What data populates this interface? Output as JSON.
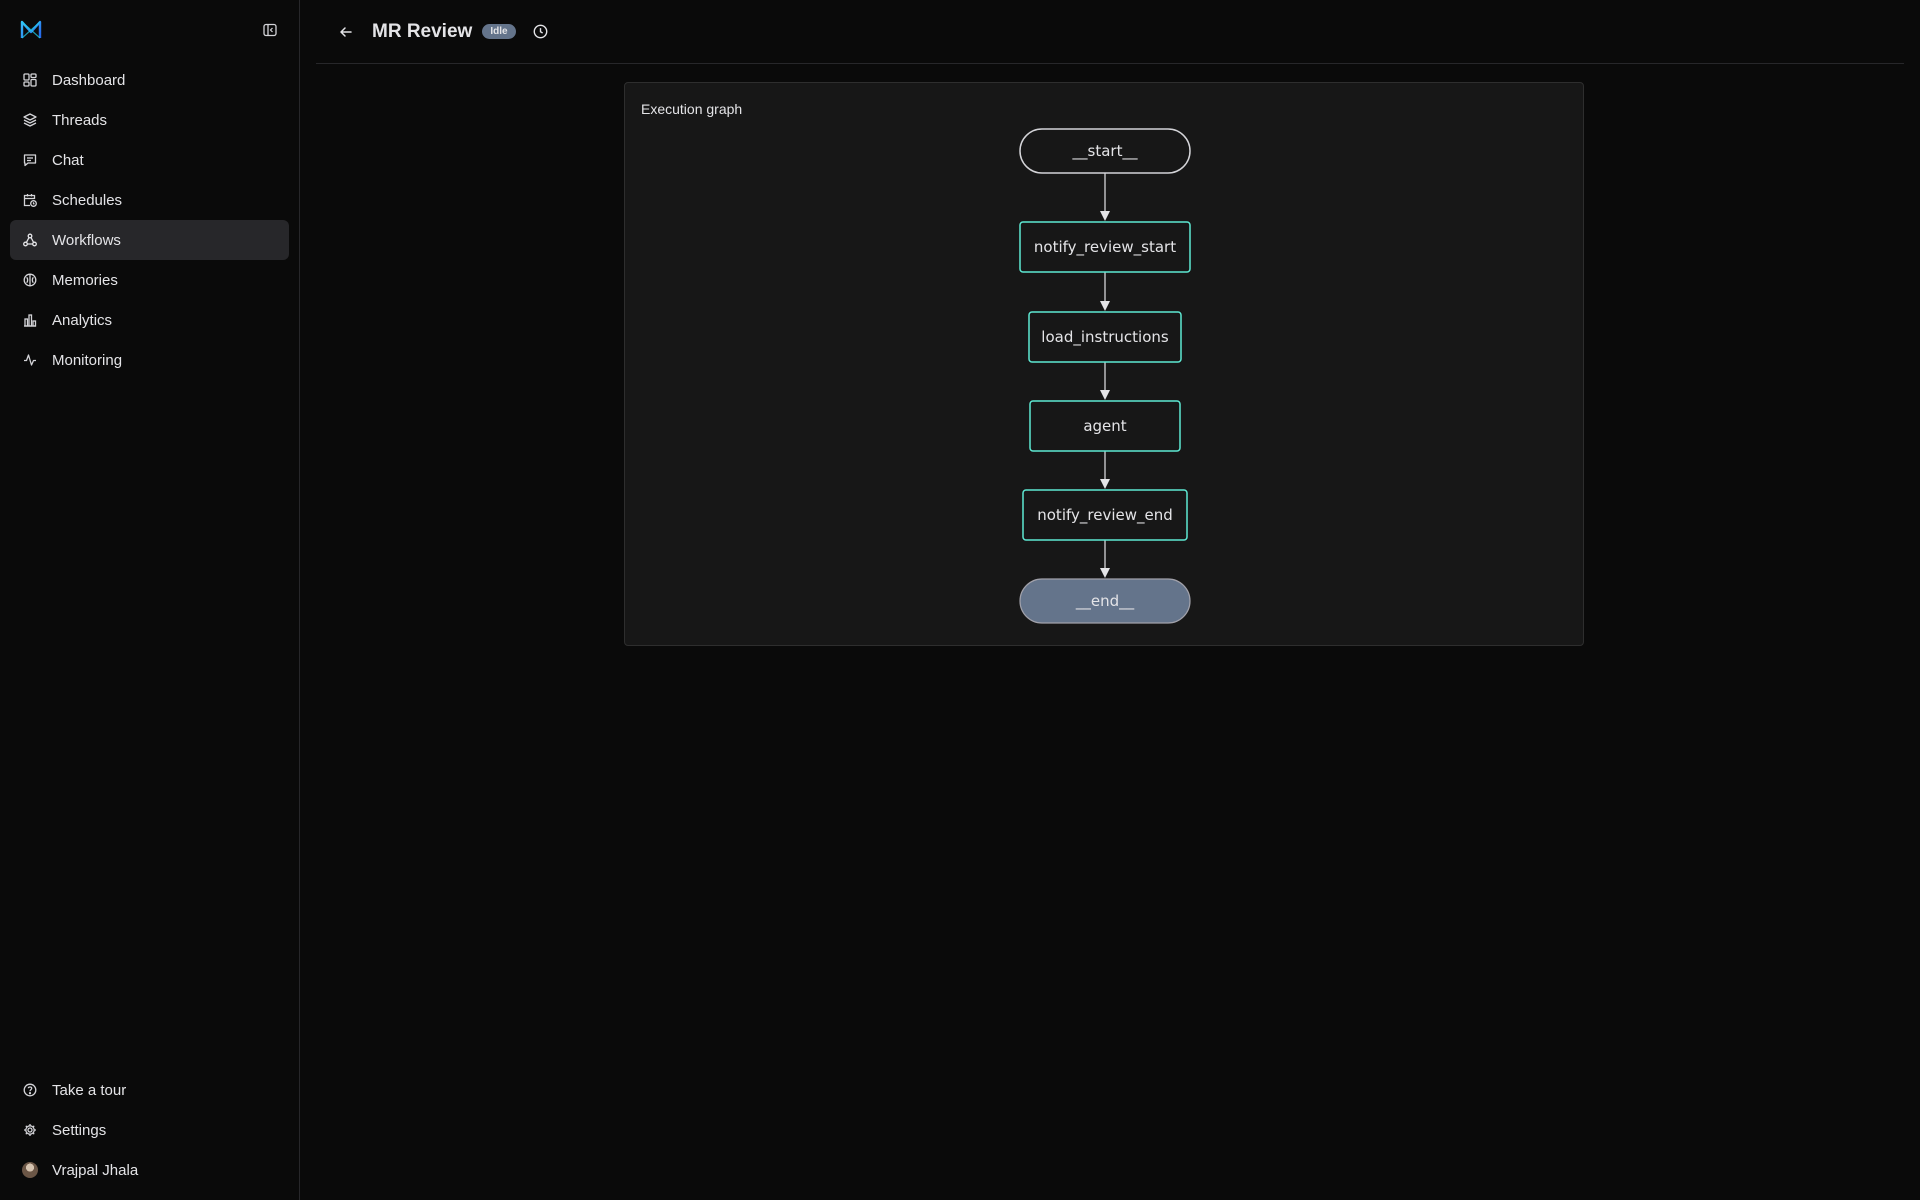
{
  "sidebar": {
    "items": [
      {
        "label": "Dashboard",
        "icon": "dashboard-icon"
      },
      {
        "label": "Threads",
        "icon": "layers-icon"
      },
      {
        "label": "Chat",
        "icon": "chat-icon"
      },
      {
        "label": "Schedules",
        "icon": "calendar-clock-icon"
      },
      {
        "label": "Workflows",
        "icon": "workflow-icon",
        "active": true
      },
      {
        "label": "Memories",
        "icon": "brain-icon"
      },
      {
        "label": "Analytics",
        "icon": "bar-chart-icon"
      },
      {
        "label": "Monitoring",
        "icon": "activity-icon"
      }
    ],
    "bottom": [
      {
        "label": "Take a tour",
        "icon": "help-circle-icon"
      },
      {
        "label": "Settings",
        "icon": "gear-icon"
      },
      {
        "label": "Vrajpal Jhala",
        "icon": "avatar"
      }
    ]
  },
  "header": {
    "title": "MR Review",
    "status": "Idle"
  },
  "graph": {
    "title": "Execution graph",
    "nodes": [
      {
        "label": "__start__",
        "kind": "start"
      },
      {
        "label": "notify_review_start",
        "kind": "step"
      },
      {
        "label": "load_instructions",
        "kind": "step"
      },
      {
        "label": "agent",
        "kind": "step"
      },
      {
        "label": "notify_review_end",
        "kind": "step"
      },
      {
        "label": "__end__",
        "kind": "end"
      }
    ]
  },
  "colors": {
    "accent": "#5eead4",
    "end_node": "#64748b",
    "badge": "#64748b"
  }
}
